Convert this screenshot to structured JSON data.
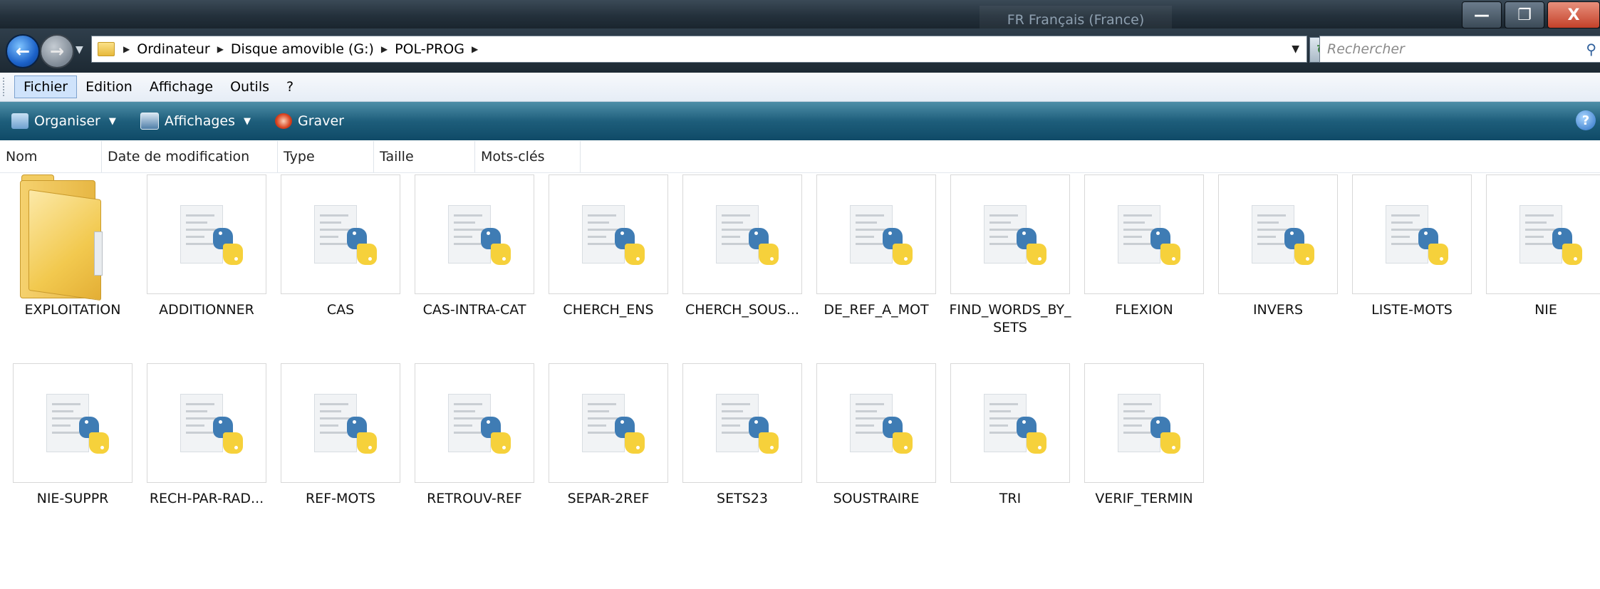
{
  "window": {
    "language_indicator": "FR Français (France)",
    "controls": {
      "minimize": "—",
      "maximize": "❐",
      "close": "X"
    }
  },
  "address_bar": {
    "breadcrumbs": [
      "Ordinateur",
      "Disque amovible (G:)",
      "POL-PROG"
    ],
    "search_placeholder": "Rechercher"
  },
  "menu": {
    "items": [
      "Fichier",
      "Edition",
      "Affichage",
      "Outils",
      "?"
    ]
  },
  "toolbar": {
    "organiser_label": "Organiser",
    "affichages_label": "Affichages",
    "graver_label": "Graver"
  },
  "columns": [
    "Nom",
    "Date de modification",
    "Type",
    "Taille",
    "Mots-clés"
  ],
  "files": {
    "row1": [
      "EXPLOITATION",
      "ADDITIONNER",
      "CAS",
      "CAS-INTRA-CAT",
      "CHERCH_ENS",
      "CHERCH_SOUS...",
      "DE_REF_A_MOT",
      "FIND_WORDS_BY_ SETS",
      "FLEXION",
      "INVERS",
      "LISTE-MOTS",
      "NIE"
    ],
    "row2": [
      "NIE-SUPPR",
      "RECH-PAR-RAD...",
      "REF-MOTS",
      "RETROUV-REF",
      "SEPAR-2REF",
      "SETS23",
      "SOUSTRAIRE",
      "TRI",
      "VERIF_TERMIN"
    ]
  },
  "icons": {
    "folder": "folder-icon",
    "python_file": "python-file-icon"
  },
  "colors": {
    "toolbar": "#1e5e7b",
    "titlebar": "#24313c",
    "menu_active": "#cfe3fb"
  }
}
